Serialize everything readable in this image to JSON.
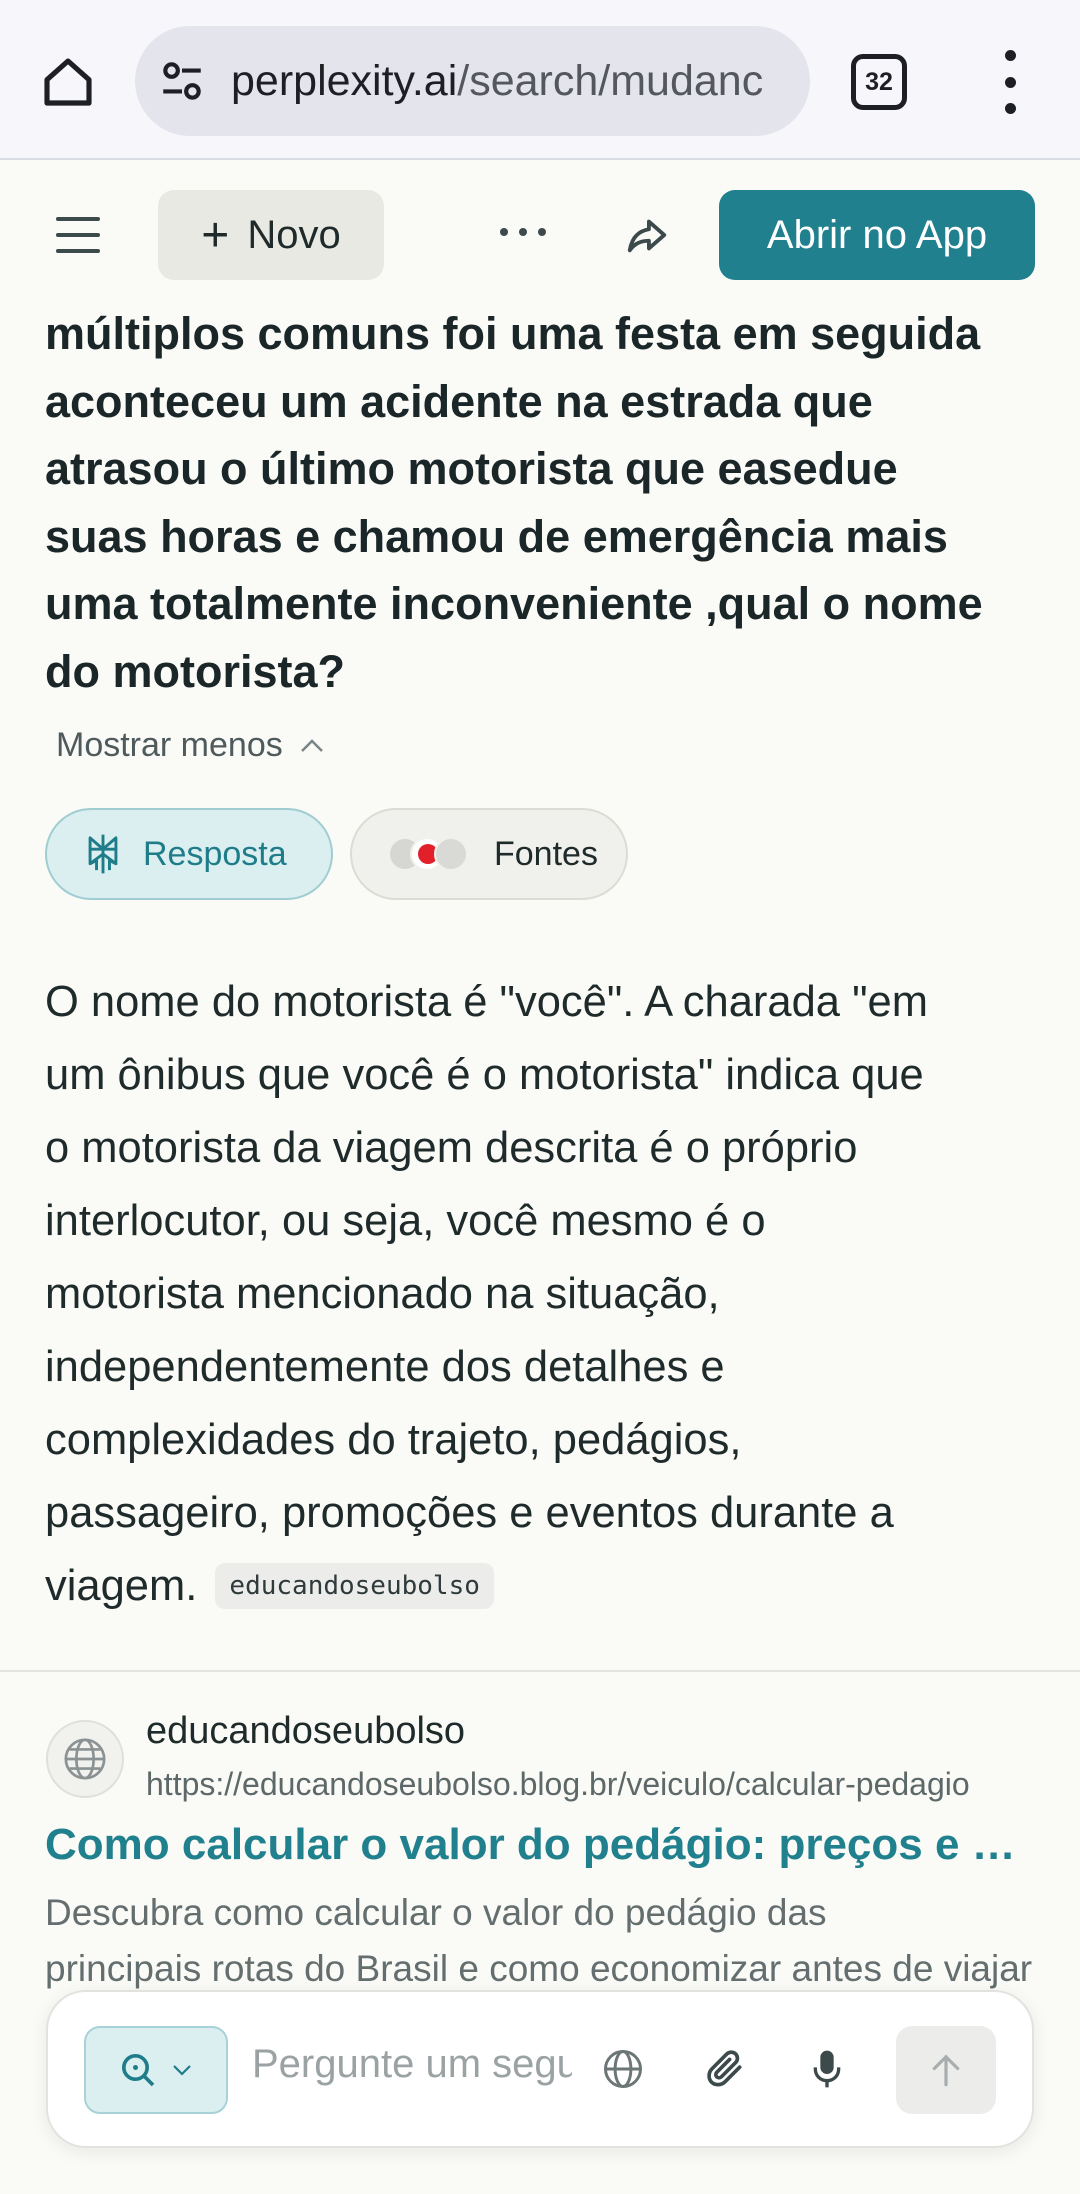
{
  "browser": {
    "url_host": "perplexity.ai",
    "url_path": "/search/mudanc",
    "tab_count": "32"
  },
  "header": {
    "new_label": "Novo",
    "open_app_label": "Abrir no App"
  },
  "question": {
    "lines": [
      "múltiplos comuns foi uma festa em seguida",
      "aconteceu um acidente na estrada que",
      "atrasou  o último motorista que easedue",
      "suas horas e chamou de emergência mais",
      "uma totalmente  inconveniente ,qual o nome",
      "do motorista?"
    ],
    "show_less_label": "Mostrar menos"
  },
  "tabs": {
    "answer_label": "Resposta",
    "sources_label": "Fontes"
  },
  "answer": {
    "lines": [
      "O nome do motorista é \"você\". A charada \"em",
      "um ônibus que você é o motorista\" indica que",
      "o motorista da viagem descrita é o próprio",
      "interlocutor, ou seja, você mesmo é o",
      "motorista mencionado na situação,",
      "independentemente dos detalhes e",
      "complexidades do trajeto, pedágios,",
      "passageiro, promoções e eventos durante a"
    ],
    "last_line": "viagem.",
    "citation": "educandoseubolso"
  },
  "source": {
    "name": "educandoseubolso",
    "url": "https://educandoseubolso.blog.br/veiculo/calcular-pedagio",
    "title": "Como calcular o valor do pedágio: preços e dicas",
    "desc_line1": "Descubra como calcular o valor do pedágio das",
    "desc_line2": "principais rotas do Brasil e como economizar antes de viajar"
  },
  "composer": {
    "placeholder": "Pergunte um seguimento"
  },
  "colors": {
    "accent": "#20808d",
    "accent_light": "#dbeef0",
    "background": "#fafaf7"
  }
}
